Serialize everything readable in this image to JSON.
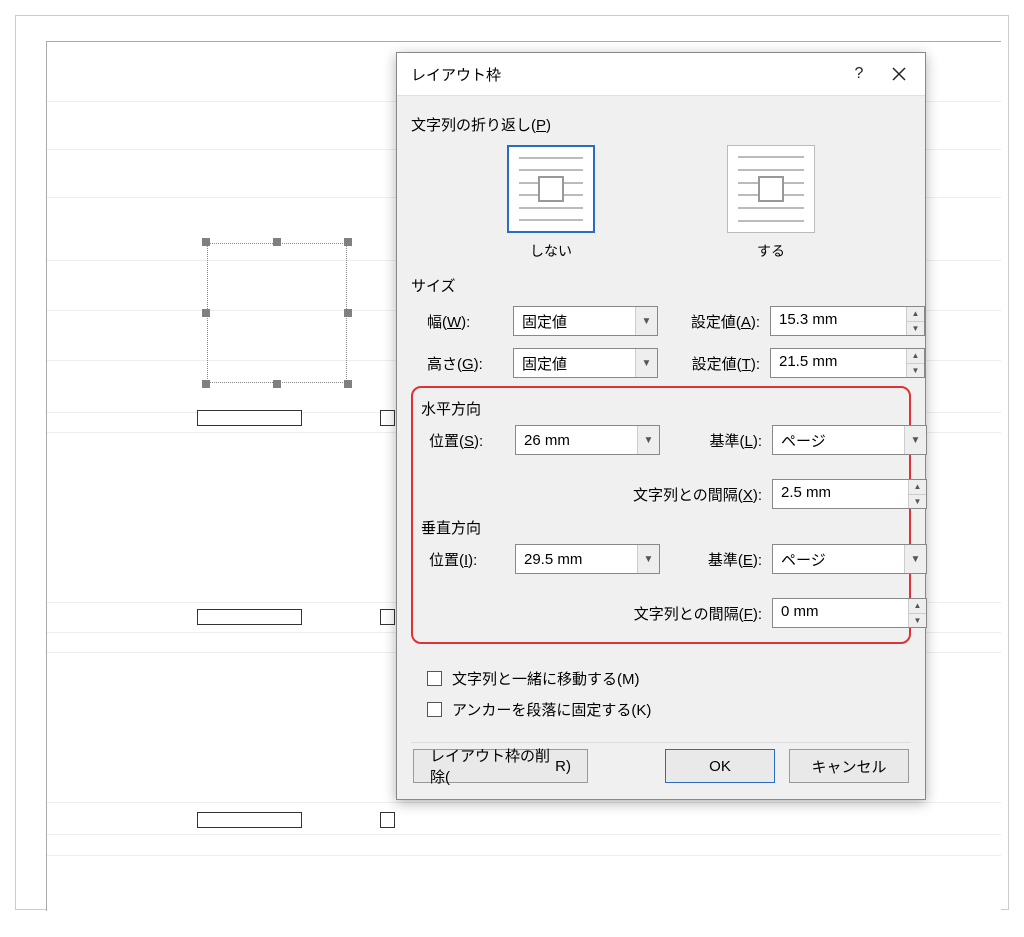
{
  "dialog": {
    "title": "レイアウト枠",
    "sections": {
      "wrap": {
        "label_text": "文字列の折り返し(",
        "label_key": "P",
        "label_end": ")",
        "option_none": "しない",
        "option_around": "する"
      },
      "size": {
        "label": "サイズ",
        "width_label": "幅(",
        "width_key": "W",
        "width_end": "):",
        "width_mode": "固定値",
        "width_setlabel": "設定値(",
        "width_setkey": "A",
        "width_setend": "):",
        "width_value": "15.3 mm",
        "height_label": "高さ(",
        "height_key": "G",
        "height_end": "):",
        "height_mode": "固定値",
        "height_setlabel": "設定値(",
        "height_setkey": "T",
        "height_setend": "):",
        "height_value": "21.5 mm"
      },
      "horizontal": {
        "label": "水平方向",
        "pos_label": "位置(",
        "pos_key": "S",
        "pos_end": "):",
        "pos_value": "26 mm",
        "ref_label": "基準(",
        "ref_key": "L",
        "ref_end": "):",
        "ref_value": "ページ",
        "gap_label": "文字列との間隔(",
        "gap_key": "X",
        "gap_end": "):",
        "gap_value": "2.5 mm"
      },
      "vertical": {
        "label": "垂直方向",
        "pos_label": "位置(",
        "pos_key": "I",
        "pos_end": "):",
        "pos_value": "29.5 mm",
        "ref_label": "基準(",
        "ref_key": "E",
        "ref_end": "):",
        "ref_value": "ページ",
        "gap_label": "文字列との間隔(",
        "gap_key": "F",
        "gap_end": "):",
        "gap_value": "0 mm"
      }
    },
    "checks": {
      "move_with_text": "文字列と一緒に移動する(",
      "move_key": "M",
      "move_end": ")",
      "lock_anchor": "アンカーを段落に固定する(",
      "lock_key": "K",
      "lock_end": ")"
    },
    "buttons": {
      "delete": "レイアウト枠の削除(",
      "delete_key": "R",
      "delete_end": ")",
      "ok": "OK",
      "cancel": "キャンセル"
    }
  }
}
